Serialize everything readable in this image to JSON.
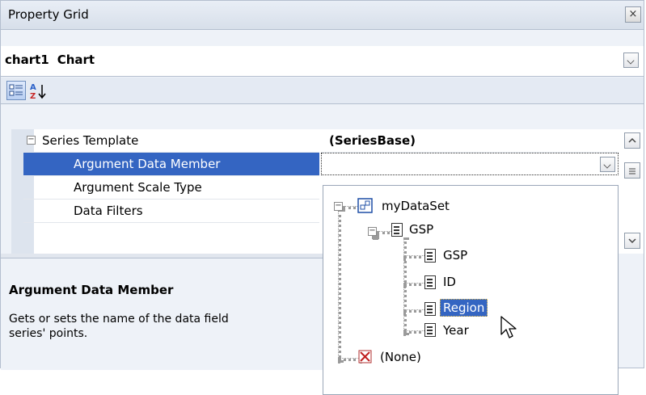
{
  "window": {
    "title": "Property Grid",
    "close_label": "×"
  },
  "object_selector": {
    "name": "chart1",
    "type": "Chart"
  },
  "toolbar": {
    "categorized_icon": "categorized-icon",
    "alphabetical_icon": "sort-az-icon",
    "az_label": "A Z"
  },
  "grid": {
    "rows": [
      {
        "name": "Series Template",
        "value": "(SeriesBase)",
        "expander": "−"
      },
      {
        "name": "Argument Data Member",
        "value": ""
      },
      {
        "name": "Argument Scale Type",
        "value": ""
      },
      {
        "name": "Data Filters",
        "value": ""
      }
    ]
  },
  "description": {
    "title": "Argument Data Member",
    "text": "Gets or sets the name of the data field\nseries' points."
  },
  "dropdown": {
    "root": "myDataSet",
    "table": "GSP",
    "fields": [
      "GSP",
      "ID",
      "Region",
      "Year"
    ],
    "selected_field": "Region",
    "none_label": "(None)",
    "expander_collapse": "−"
  },
  "colors": {
    "selection": "#3465c2",
    "panel_bg": "#eef2f8",
    "border": "#b4bfcf"
  }
}
